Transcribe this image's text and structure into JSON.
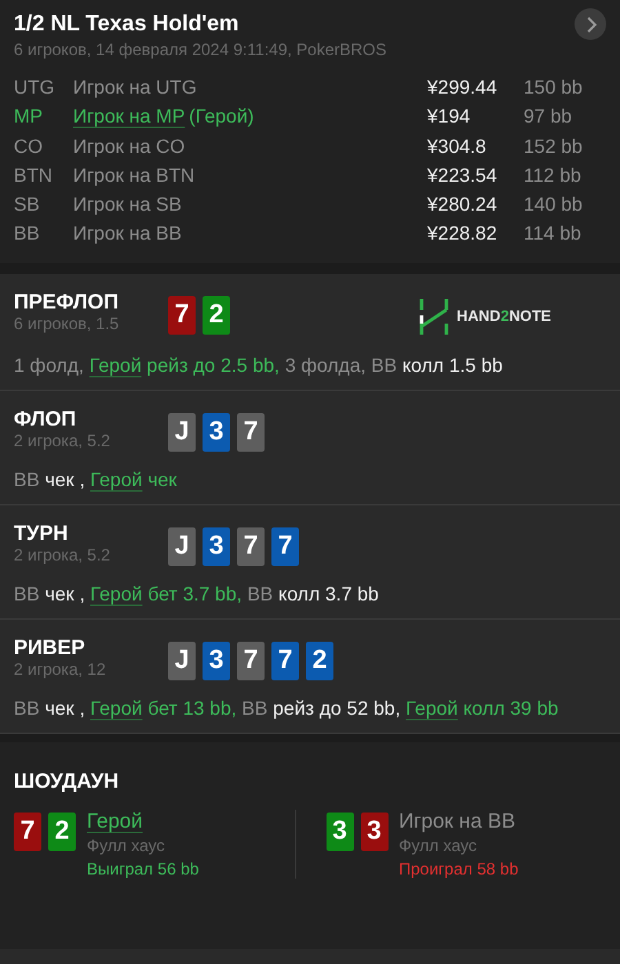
{
  "header": {
    "title": "1/2 NL Texas Hold'em",
    "subtitle": "6 игроков, 14 февраля 2024 9:11:49, PokerBROS"
  },
  "players": [
    {
      "position": "UTG",
      "name": "Игрок на UTG",
      "hero": false,
      "stack": "¥299.44",
      "bb": "150 bb"
    },
    {
      "position": "MP",
      "name": "Игрок на MP",
      "tag": "(Герой)",
      "hero": true,
      "stack": "¥194",
      "bb": "97 bb"
    },
    {
      "position": "CO",
      "name": "Игрок на CO",
      "hero": false,
      "stack": "¥304.8",
      "bb": "152 bb"
    },
    {
      "position": "BTN",
      "name": "Игрок на BTN",
      "hero": false,
      "stack": "¥223.54",
      "bb": "112 bb"
    },
    {
      "position": "SB",
      "name": "Игрок на SB",
      "hero": false,
      "stack": "¥280.24",
      "bb": "140 bb"
    },
    {
      "position": "BB",
      "name": "Игрок на BB",
      "hero": false,
      "stack": "¥228.82",
      "bb": "114 bb"
    }
  ],
  "streets": [
    {
      "name": "ПРЕФЛОП",
      "info": "6 игроков, 1.5",
      "logo": {
        "before": "HAND",
        "accent": "2",
        "after": "NOTE"
      },
      "cards": [
        {
          "rank": "7",
          "color": "#9a0e0e"
        },
        {
          "rank": "2",
          "color": "#0e8a17"
        }
      ],
      "actions": [
        {
          "text": "1 фолд,",
          "kind": "muted"
        },
        {
          "text": "Герой",
          "kind": "hero"
        },
        {
          "text": "рейз до 2.5 bb,",
          "kind": "green"
        },
        {
          "text": "3 фолда, BB",
          "kind": "muted"
        },
        {
          "text": "колл 1.5 bb",
          "kind": "bright"
        }
      ]
    },
    {
      "name": "ФЛОП",
      "info": "2 игрока, 5.2",
      "cards": [
        {
          "rank": "J",
          "color": "#5e5e5e"
        },
        {
          "rank": "3",
          "color": "#0c5bb0"
        },
        {
          "rank": "7",
          "color": "#5e5e5e"
        }
      ],
      "actions": [
        {
          "text": "BB",
          "kind": "muted"
        },
        {
          "text": "чек ,",
          "kind": "bright"
        },
        {
          "text": "Герой",
          "kind": "hero"
        },
        {
          "text": "чек",
          "kind": "green"
        }
      ]
    },
    {
      "name": "ТУРН",
      "info": "2 игрока, 5.2",
      "cards": [
        {
          "rank": "J",
          "color": "#5e5e5e"
        },
        {
          "rank": "3",
          "color": "#0c5bb0"
        },
        {
          "rank": "7",
          "color": "#5e5e5e"
        },
        {
          "rank": "7",
          "color": "#0c5bb0"
        }
      ],
      "actions": [
        {
          "text": "BB",
          "kind": "muted"
        },
        {
          "text": "чек ,",
          "kind": "bright"
        },
        {
          "text": "Герой",
          "kind": "hero"
        },
        {
          "text": "бет 3.7 bb,",
          "kind": "green"
        },
        {
          "text": "BB",
          "kind": "muted"
        },
        {
          "text": "колл 3.7 bb",
          "kind": "bright"
        }
      ]
    },
    {
      "name": "РИВЕР",
      "info": "2 игрока, 12",
      "cards": [
        {
          "rank": "J",
          "color": "#5e5e5e"
        },
        {
          "rank": "3",
          "color": "#0c5bb0"
        },
        {
          "rank": "7",
          "color": "#5e5e5e"
        },
        {
          "rank": "7",
          "color": "#0c5bb0"
        },
        {
          "rank": "2",
          "color": "#0c5bb0"
        }
      ],
      "actions": [
        {
          "text": "BB",
          "kind": "muted"
        },
        {
          "text": "чек ,",
          "kind": "bright"
        },
        {
          "text": "Герой",
          "kind": "hero"
        },
        {
          "text": "бет 13 bb,",
          "kind": "green"
        },
        {
          "text": "BB",
          "kind": "muted"
        },
        {
          "text": "рейз до 52 bb,",
          "kind": "bright"
        },
        {
          "text": "Герой",
          "kind": "hero"
        },
        {
          "text": "колл 39 bb",
          "kind": "green"
        }
      ]
    }
  ],
  "showdown": {
    "title": "ШОУДАУН",
    "players": [
      {
        "name": "Герой",
        "hero": true,
        "hand": "Фулл хаус",
        "result": "Выиграл 56 bb",
        "won": true,
        "cards": [
          {
            "rank": "7",
            "color": "#9a0e0e"
          },
          {
            "rank": "2",
            "color": "#0e8a17"
          }
        ]
      },
      {
        "name": "Игрок на BB",
        "hero": false,
        "hand": "Фулл хаус",
        "result": "Проиграл 58 bb",
        "won": false,
        "cards": [
          {
            "rank": "3",
            "color": "#0e8a17"
          },
          {
            "rank": "3",
            "color": "#9a0e0e"
          }
        ]
      }
    ]
  }
}
